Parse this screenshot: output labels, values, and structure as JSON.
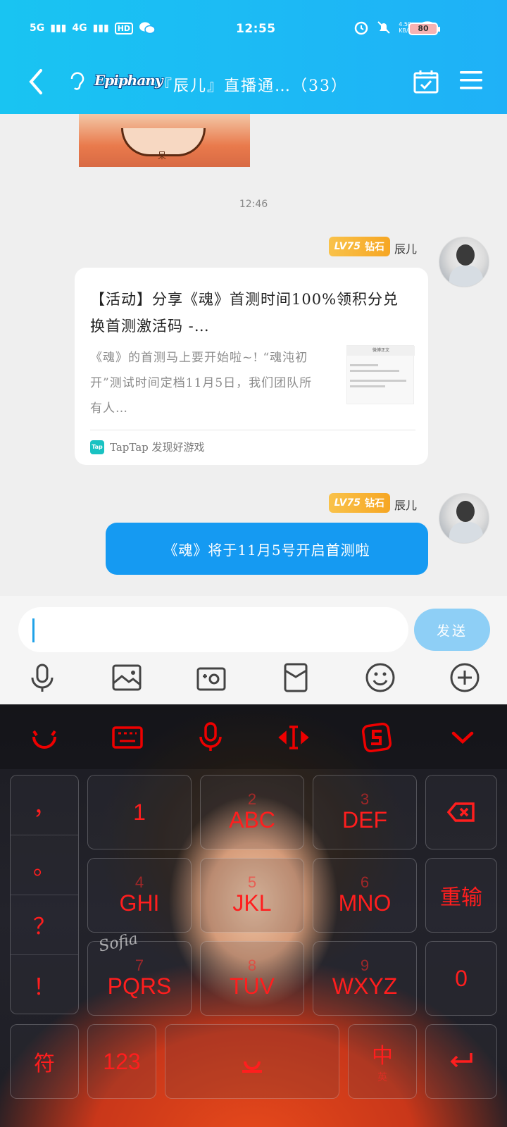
{
  "status_bar": {
    "network1": "5G",
    "network2": "4G",
    "hd": "HD",
    "time": "12:55",
    "net_speed_value": "4.50",
    "net_speed_unit": "KB/s",
    "battery": "80"
  },
  "header": {
    "logo_text": "Epiphany",
    "title": "『辰儿』直播通…（33）"
  },
  "chat": {
    "timestamp": "12:46",
    "messages": [
      {
        "sender": {
          "level": "LV75",
          "rank": "钻石",
          "name": "辰儿"
        },
        "card": {
          "title": "【活动】分享《魂》首测时间100%领积分兑换首测激活码 -…",
          "description": "《魂》的首测马上要开始啦~! “魂沌初开”测试时间定档11月5日，我们团队所有人…",
          "thumb_header": "微博正文",
          "source_icon": "Tap",
          "source": "TapTap 发现好游戏"
        }
      },
      {
        "sender": {
          "level": "LV75",
          "rank": "钻石",
          "name": "辰儿"
        },
        "text": "《魂》将于11月5号开启首测啦"
      }
    ]
  },
  "input": {
    "value": "",
    "send_label": "发送"
  },
  "image_tag": "呆",
  "keyboard": {
    "punct": [
      "，",
      "。",
      "？",
      "！"
    ],
    "row1": [
      {
        "num": "1",
        "label": ""
      },
      {
        "num": "2",
        "label": "ABC"
      },
      {
        "num": "3",
        "label": "DEF"
      }
    ],
    "row2": [
      {
        "num": "4",
        "label": "GHI"
      },
      {
        "num": "5",
        "label": "JKL"
      },
      {
        "num": "6",
        "label": "MNO"
      }
    ],
    "row3": [
      {
        "num": "7",
        "label": "PQRS"
      },
      {
        "num": "8",
        "label": "TUV"
      },
      {
        "num": "9",
        "label": "WXYZ"
      }
    ],
    "reinput": "重输",
    "zero": "0",
    "symbols": "符",
    "num_mode": "123",
    "lang": "中",
    "lang_sub": "英",
    "signature": "Sofia",
    "colors": {
      "key_text": "#ff1e1e",
      "accent": "#1fb1f7",
      "bubble": "#159af2"
    }
  }
}
